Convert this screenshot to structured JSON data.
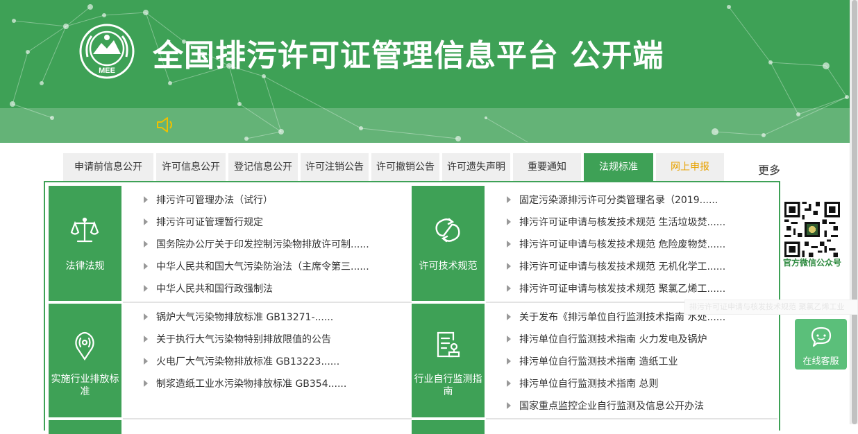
{
  "header": {
    "title": "全国排污许可证管理信息平台  公开端",
    "logo_text": "MEE"
  },
  "tabs": [
    {
      "label": "申请前信息公开"
    },
    {
      "label": "许可信息公开"
    },
    {
      "label": "登记信息公开"
    },
    {
      "label": "许可注销公告"
    },
    {
      "label": "许可撤销公告"
    },
    {
      "label": "许可遗失声明"
    },
    {
      "label": "重要通知"
    },
    {
      "label": "法规标准"
    },
    {
      "label": "网上申报"
    }
  ],
  "more_label": "更多",
  "sections": [
    {
      "label": "法律法规",
      "icon": "scales-icon",
      "items": [
        "排污许可管理办法（试行）",
        "排污许可证管理暂行规定",
        "国务院办公厅关于印发控制污染物排放许可制......",
        "中华人民共和国大气污染防治法（主席令第三......",
        "中华人民共和国行政强制法"
      ]
    },
    {
      "label": "许可技术规范",
      "icon": "recycle-knot-icon",
      "items": [
        "固定污染源排污许可分类管理名录（2019......",
        "排污许可证申请与核发技术规范 生活垃圾焚......",
        "排污许可证申请与核发技术规范 危险废物焚......",
        "排污许可证申请与核发技术规范 无机化学工......",
        "排污许可证申请与核发技术规范 聚氯乙烯工......"
      ]
    },
    {
      "label": "实施行业排放标准",
      "icon": "signal-pin-icon",
      "items": [
        "锅炉大气污染物排放标准 GB13271-......",
        "关于执行大气污染物特别排放限值的公告",
        "火电厂大气污染物排放标准 GB13223......",
        "制浆造纸工业水污染物排放标准 GB354......"
      ]
    },
    {
      "label": "行业自行监测指南",
      "icon": "document-stamp-icon",
      "items": [
        "关于发布《排污单位自行监测技术指南 水处......",
        "排污单位自行监测技术指南 火力发电及锅炉",
        "排污单位自行监测技术指南 造纸工业",
        "排污单位自行监测技术指南 总则",
        "国家重点监控企业自行监测及信息公开办法"
      ]
    }
  ],
  "qr_label": "官方微信公众号",
  "service_label": "在线客服",
  "ghost_text": "排污许可证申请与核发技术规范 聚氯乙烯工业"
}
